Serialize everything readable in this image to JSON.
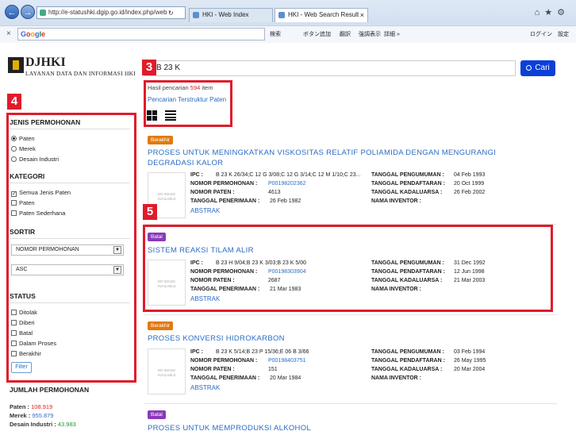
{
  "browser": {
    "url": "http://e-statushki.dgip.go.id/index.php/web",
    "tabs": [
      {
        "label": "HKI - Web Index"
      },
      {
        "label": "HKI - Web Search Result"
      }
    ],
    "google_label": "Google",
    "toolbar": {
      "search": "検索",
      "button_add": "ボタン追加",
      "translate": "翻訳",
      "highlight": "強調表示",
      "details": "詳細 »",
      "login": "ログイン",
      "settings": "設定"
    }
  },
  "logo": {
    "title": "DJHKI",
    "subtitle": "LAYANAN DATA DAN INFORMASI HKI"
  },
  "search": {
    "query": "B 23 K",
    "button": "Cari"
  },
  "results_summary": {
    "prefix": "Hasil pencarian",
    "count": "594",
    "suffix": "item",
    "structured_link": "Pencarian Terstruktur Paten"
  },
  "callouts": {
    "c3": "3",
    "c4": "4",
    "c5": "5"
  },
  "sidebar": {
    "jenis_heading": "JENIS PERMOHONAN",
    "jenis_options": [
      "Paten",
      "Merek",
      "Desain Industri"
    ],
    "kategori_heading": "KATEGORI",
    "kategori_options": [
      "Semua Jenis Paten",
      "Paten",
      "Paten Sederhana"
    ],
    "sortir_heading": "SORTIR",
    "sort_field": "NOMOR PERMOHONAN",
    "sort_order": "ASC",
    "status_heading": "STATUS",
    "status_options": [
      "Ditolak",
      "Diberi",
      "Batal",
      "Dalam Proses",
      "Berakhir"
    ],
    "filter_button": "Filter",
    "jumlah_heading": "JUMLAH PERMOHONAN",
    "counts": [
      {
        "label": "Paten :",
        "value": "108.919",
        "color": "#e02020"
      },
      {
        "label": "Merek :",
        "value": "955.879",
        "color": "#2b6cc4"
      },
      {
        "label": "Desain Industri :",
        "value": "43.983",
        "color": "#1a9a2a"
      }
    ]
  },
  "labels": {
    "ipc": "IPC :",
    "nomor_permohonan": "NOMOR PERMOHONAN :",
    "nomor_paten": "NOMOR PATEN :",
    "tanggal_penerimaan": "TANGGAL PENERIMAAN :",
    "tanggal_pengumuman": "TANGGAL PENGUMUMAN :",
    "tanggal_pendaftaran": "TANGGAL PENDAFTARAN :",
    "tanggal_kadaluarsa": "TANGGAL KADALUARSA :",
    "nama_inventor": "NAMA INVENTOR :",
    "abstrak": "ABSTRAK",
    "no_image": "NO IMAGE AVAILABLE"
  },
  "results": [
    {
      "status": "Berakhir",
      "status_color": "#e07a10",
      "title": "PROSES UNTUK MENINGKATKAN VISKOSITAS RELATIF POLIAMIDA DENGAN MENGURANGI DEGRADASI KALOR",
      "ipc": "B 23 K 26/34;C 12 G 3/08;C 12 G 3/14;C 12 M 1/10;C 23...",
      "nomor_permohonan": "P00198202362",
      "nomor_paten": "4613",
      "tanggal_penerimaan": "26 Feb 1982",
      "tanggal_pengumuman": "04 Feb 1993",
      "tanggal_pendaftaran": "20 Oct 1999",
      "tanggal_kadaluarsa": "26 Feb 2002",
      "nama_inventor": ""
    },
    {
      "status": "Batal",
      "status_color": "#8a3ab9",
      "title": "SISTEM REAKSI TILAM ALIR",
      "ipc": "B 23 H 9/04;B 23 K 3/03;B 23 K 5/00",
      "nomor_permohonan": "P00198303904",
      "nomor_paten": "2687",
      "tanggal_penerimaan": "21 Mar 1983",
      "tanggal_pengumuman": "31 Dec 1992",
      "tanggal_pendaftaran": "12 Jun 1998",
      "tanggal_kadaluarsa": "21 Mar 2003",
      "nama_inventor": ""
    },
    {
      "status": "Berakhir",
      "status_color": "#e07a10",
      "title": "PROSES KONVERSI HIDROKARBON",
      "ipc": "B 23 K 5/14;B 23 P 15/36;E 06 B 3/66",
      "nomor_permohonan": "P00198403751",
      "nomor_paten": "151",
      "tanggal_penerimaan": "20 Mar 1984",
      "tanggal_pengumuman": "03 Feb 1994",
      "tanggal_pendaftaran": "26 May 1995",
      "tanggal_kadaluarsa": "20 Mar 2004",
      "nama_inventor": ""
    },
    {
      "status": "Batal",
      "status_color": "#8a3ab9",
      "title": "PROSES UNTUK MEMPRODUKSI ALKOHOL"
    }
  ]
}
